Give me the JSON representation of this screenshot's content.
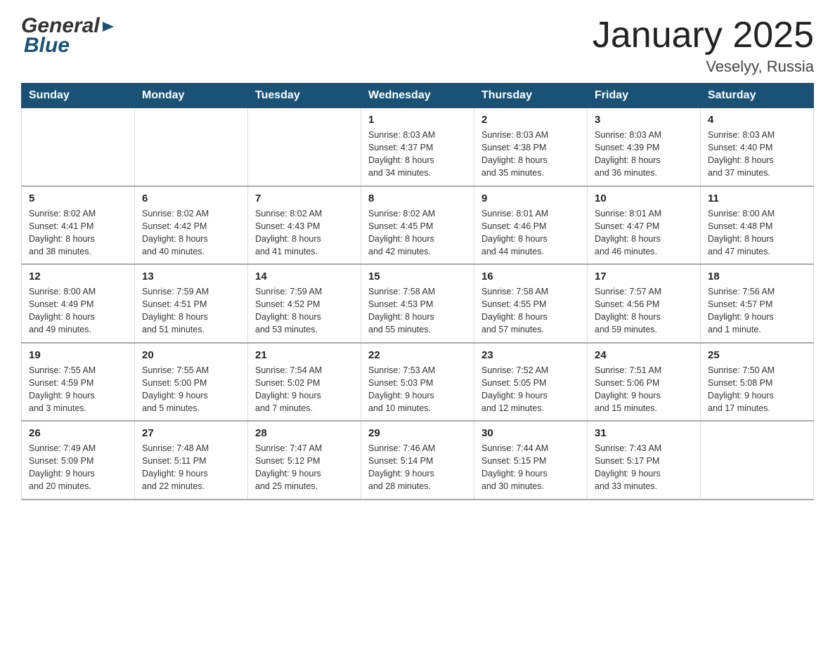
{
  "header": {
    "logo_general": "General",
    "logo_blue": "Blue",
    "title": "January 2025",
    "subtitle": "Veselyy, Russia"
  },
  "weekdays": [
    "Sunday",
    "Monday",
    "Tuesday",
    "Wednesday",
    "Thursday",
    "Friday",
    "Saturday"
  ],
  "weeks": [
    [
      {
        "day": "",
        "info": ""
      },
      {
        "day": "",
        "info": ""
      },
      {
        "day": "",
        "info": ""
      },
      {
        "day": "1",
        "info": "Sunrise: 8:03 AM\nSunset: 4:37 PM\nDaylight: 8 hours\nand 34 minutes."
      },
      {
        "day": "2",
        "info": "Sunrise: 8:03 AM\nSunset: 4:38 PM\nDaylight: 8 hours\nand 35 minutes."
      },
      {
        "day": "3",
        "info": "Sunrise: 8:03 AM\nSunset: 4:39 PM\nDaylight: 8 hours\nand 36 minutes."
      },
      {
        "day": "4",
        "info": "Sunrise: 8:03 AM\nSunset: 4:40 PM\nDaylight: 8 hours\nand 37 minutes."
      }
    ],
    [
      {
        "day": "5",
        "info": "Sunrise: 8:02 AM\nSunset: 4:41 PM\nDaylight: 8 hours\nand 38 minutes."
      },
      {
        "day": "6",
        "info": "Sunrise: 8:02 AM\nSunset: 4:42 PM\nDaylight: 8 hours\nand 40 minutes."
      },
      {
        "day": "7",
        "info": "Sunrise: 8:02 AM\nSunset: 4:43 PM\nDaylight: 8 hours\nand 41 minutes."
      },
      {
        "day": "8",
        "info": "Sunrise: 8:02 AM\nSunset: 4:45 PM\nDaylight: 8 hours\nand 42 minutes."
      },
      {
        "day": "9",
        "info": "Sunrise: 8:01 AM\nSunset: 4:46 PM\nDaylight: 8 hours\nand 44 minutes."
      },
      {
        "day": "10",
        "info": "Sunrise: 8:01 AM\nSunset: 4:47 PM\nDaylight: 8 hours\nand 46 minutes."
      },
      {
        "day": "11",
        "info": "Sunrise: 8:00 AM\nSunset: 4:48 PM\nDaylight: 8 hours\nand 47 minutes."
      }
    ],
    [
      {
        "day": "12",
        "info": "Sunrise: 8:00 AM\nSunset: 4:49 PM\nDaylight: 8 hours\nand 49 minutes."
      },
      {
        "day": "13",
        "info": "Sunrise: 7:59 AM\nSunset: 4:51 PM\nDaylight: 8 hours\nand 51 minutes."
      },
      {
        "day": "14",
        "info": "Sunrise: 7:59 AM\nSunset: 4:52 PM\nDaylight: 8 hours\nand 53 minutes."
      },
      {
        "day": "15",
        "info": "Sunrise: 7:58 AM\nSunset: 4:53 PM\nDaylight: 8 hours\nand 55 minutes."
      },
      {
        "day": "16",
        "info": "Sunrise: 7:58 AM\nSunset: 4:55 PM\nDaylight: 8 hours\nand 57 minutes."
      },
      {
        "day": "17",
        "info": "Sunrise: 7:57 AM\nSunset: 4:56 PM\nDaylight: 8 hours\nand 59 minutes."
      },
      {
        "day": "18",
        "info": "Sunrise: 7:56 AM\nSunset: 4:57 PM\nDaylight: 9 hours\nand 1 minute."
      }
    ],
    [
      {
        "day": "19",
        "info": "Sunrise: 7:55 AM\nSunset: 4:59 PM\nDaylight: 9 hours\nand 3 minutes."
      },
      {
        "day": "20",
        "info": "Sunrise: 7:55 AM\nSunset: 5:00 PM\nDaylight: 9 hours\nand 5 minutes."
      },
      {
        "day": "21",
        "info": "Sunrise: 7:54 AM\nSunset: 5:02 PM\nDaylight: 9 hours\nand 7 minutes."
      },
      {
        "day": "22",
        "info": "Sunrise: 7:53 AM\nSunset: 5:03 PM\nDaylight: 9 hours\nand 10 minutes."
      },
      {
        "day": "23",
        "info": "Sunrise: 7:52 AM\nSunset: 5:05 PM\nDaylight: 9 hours\nand 12 minutes."
      },
      {
        "day": "24",
        "info": "Sunrise: 7:51 AM\nSunset: 5:06 PM\nDaylight: 9 hours\nand 15 minutes."
      },
      {
        "day": "25",
        "info": "Sunrise: 7:50 AM\nSunset: 5:08 PM\nDaylight: 9 hours\nand 17 minutes."
      }
    ],
    [
      {
        "day": "26",
        "info": "Sunrise: 7:49 AM\nSunset: 5:09 PM\nDaylight: 9 hours\nand 20 minutes."
      },
      {
        "day": "27",
        "info": "Sunrise: 7:48 AM\nSunset: 5:11 PM\nDaylight: 9 hours\nand 22 minutes."
      },
      {
        "day": "28",
        "info": "Sunrise: 7:47 AM\nSunset: 5:12 PM\nDaylight: 9 hours\nand 25 minutes."
      },
      {
        "day": "29",
        "info": "Sunrise: 7:46 AM\nSunset: 5:14 PM\nDaylight: 9 hours\nand 28 minutes."
      },
      {
        "day": "30",
        "info": "Sunrise: 7:44 AM\nSunset: 5:15 PM\nDaylight: 9 hours\nand 30 minutes."
      },
      {
        "day": "31",
        "info": "Sunrise: 7:43 AM\nSunset: 5:17 PM\nDaylight: 9 hours\nand 33 minutes."
      },
      {
        "day": "",
        "info": ""
      }
    ]
  ]
}
